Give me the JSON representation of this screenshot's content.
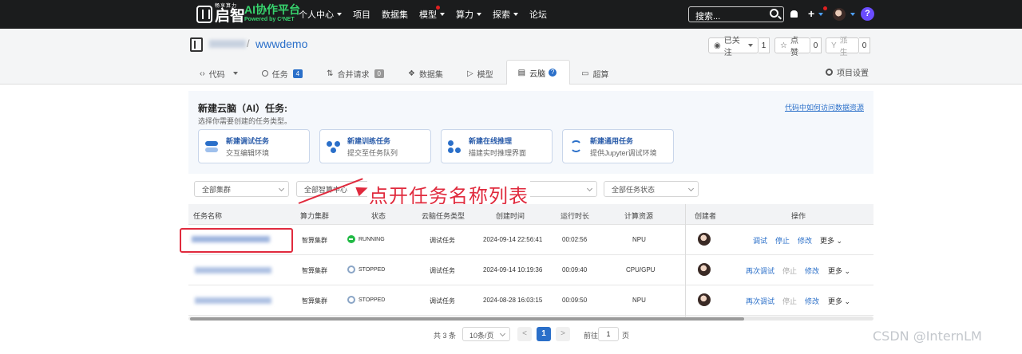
{
  "topnav": {
    "logo_sub": "畅享算力",
    "logo_main": "启智",
    "brand_title": "AI协作平台",
    "brand_sub": "Powered by C²NET",
    "items": [
      "个人中心",
      "项目",
      "数据集",
      "模型",
      "算力",
      "探索",
      "论坛"
    ],
    "search_placeholder": "搜索...",
    "plus": "+",
    "help": "?"
  },
  "repo": {
    "sep": "/",
    "name": "wwwdemo",
    "watch_label": "已关注",
    "watch_count": "1",
    "star_label": "点赞",
    "star_count": "0",
    "fork_label": "派生",
    "fork_count": "0",
    "tabs": [
      {
        "label": "代码"
      },
      {
        "label": "任务",
        "badge": "4"
      },
      {
        "label": "合并请求",
        "badge": "0"
      },
      {
        "label": "数据集"
      },
      {
        "label": "模型"
      },
      {
        "label": "云脑",
        "help": "?"
      },
      {
        "label": "超算"
      }
    ],
    "settings_label": "项目设置"
  },
  "panel": {
    "title": "新建云脑（AI）任务:",
    "subtitle": "选择你需要创建的任务类型。",
    "link": "代码中如何访问数据资源",
    "cards": [
      {
        "title": "新建调试任务",
        "desc": "交互编辑环境"
      },
      {
        "title": "新建训练任务",
        "desc": "提交至任务队列"
      },
      {
        "title": "新建在线推理",
        "desc": "描建实时推理界面"
      },
      {
        "title": "新建通用任务",
        "desc": "提供Jupyter调试环境"
      }
    ]
  },
  "filters": [
    "全部集群",
    "全部智算中心",
    "全部任务状态"
  ],
  "annotation": "点开任务名称列表",
  "table": {
    "headers": [
      "任务名称",
      "算力集群",
      "状态",
      "云脑任务类型",
      "创建时间",
      "运行时长",
      "计算资源",
      "创建者",
      "操作"
    ],
    "rows": [
      {
        "cluster": "智算集群",
        "status": "RUNNING",
        "type": "调试任务",
        "created": "2024-09-14 22:56:41",
        "duration": "00:02:56",
        "resource": "NPU",
        "actions": [
          "调试",
          "停止",
          "修改",
          "更多"
        ]
      },
      {
        "cluster": "智算集群",
        "status": "STOPPED",
        "type": "调试任务",
        "created": "2024-09-14 10:19:36",
        "duration": "00:09:40",
        "resource": "CPU/GPU",
        "actions": [
          "再次调试",
          "停止",
          "修改",
          "更多"
        ]
      },
      {
        "cluster": "智算集群",
        "status": "STOPPED",
        "type": "调试任务",
        "created": "2024-08-28 16:03:15",
        "duration": "00:09:50",
        "resource": "NPU",
        "actions": [
          "再次调试",
          "停止",
          "修改",
          "更多"
        ]
      }
    ]
  },
  "pagination": {
    "total": "共 3 条",
    "page_size": "10条/页",
    "prev": "<",
    "current": "1",
    "next": ">",
    "goto": "前往",
    "goto_value": "1",
    "page": "页"
  },
  "watermark": "CSDN @InternLM",
  "colors": {
    "accent": "#2a6fc9",
    "running": "#21ba45",
    "annotation": "#e02a3d",
    "brand": "#37d46e"
  }
}
